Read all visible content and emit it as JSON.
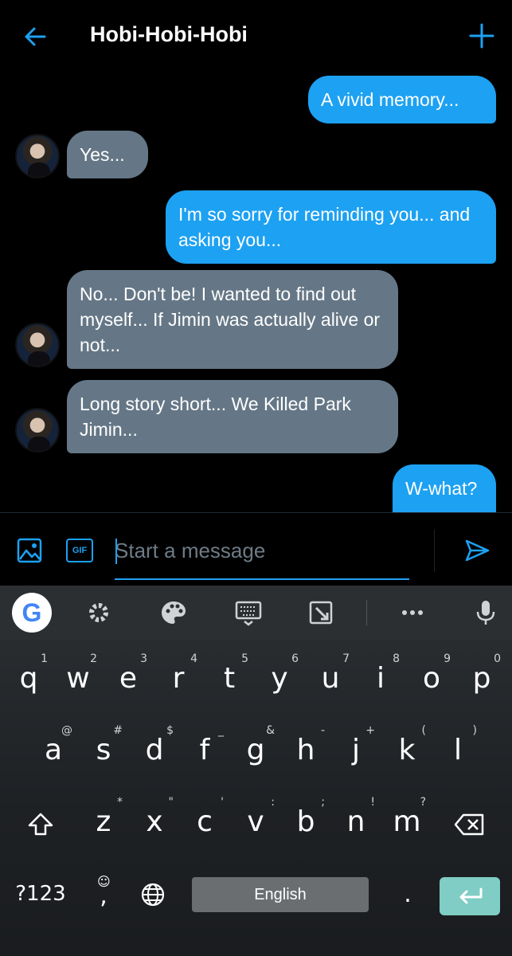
{
  "header": {
    "title": "Hobi-Hobi-Hobi"
  },
  "messages": [
    {
      "dir": "out",
      "text": "A vivid memory..."
    },
    {
      "dir": "in",
      "text": "Yes..."
    },
    {
      "dir": "out",
      "text": "I'm so sorry for reminding you... and asking you..."
    },
    {
      "dir": "in",
      "text": "No... Don't be! I wanted to find out myself... If Jimin was actually alive or not..."
    },
    {
      "dir": "in",
      "text": "Long story short... We Killed Park Jimin..."
    },
    {
      "dir": "out",
      "text": "W-what?"
    }
  ],
  "composer": {
    "gif_label": "GIF",
    "placeholder": "Start a message"
  },
  "keyboard": {
    "row1": [
      {
        "k": "q",
        "s": "1"
      },
      {
        "k": "w",
        "s": "2"
      },
      {
        "k": "e",
        "s": "3"
      },
      {
        "k": "r",
        "s": "4"
      },
      {
        "k": "t",
        "s": "5"
      },
      {
        "k": "y",
        "s": "6"
      },
      {
        "k": "u",
        "s": "7"
      },
      {
        "k": "i",
        "s": "8"
      },
      {
        "k": "o",
        "s": "9"
      },
      {
        "k": "p",
        "s": "0"
      }
    ],
    "row2": [
      {
        "k": "a",
        "s": "@"
      },
      {
        "k": "s",
        "s": "#"
      },
      {
        "k": "d",
        "s": "$"
      },
      {
        "k": "f",
        "s": "_"
      },
      {
        "k": "g",
        "s": "&"
      },
      {
        "k": "h",
        "s": "-"
      },
      {
        "k": "j",
        "s": "+"
      },
      {
        "k": "k",
        "s": "("
      },
      {
        "k": "l",
        "s": ")"
      }
    ],
    "row3": [
      {
        "k": "z",
        "s": "*"
      },
      {
        "k": "x",
        "s": "\""
      },
      {
        "k": "c",
        "s": "'"
      },
      {
        "k": "v",
        "s": ":"
      },
      {
        "k": "b",
        "s": ";"
      },
      {
        "k": "n",
        "s": "!"
      },
      {
        "k": "m",
        "s": "?"
      }
    ],
    "symbols_label": "?123",
    "comma_label": ",",
    "period_label": ".",
    "space_label": "English"
  },
  "colors": {
    "accent": "#1da1f2",
    "incoming_bubble": "#657786",
    "enter_key": "#7fcdc4"
  }
}
